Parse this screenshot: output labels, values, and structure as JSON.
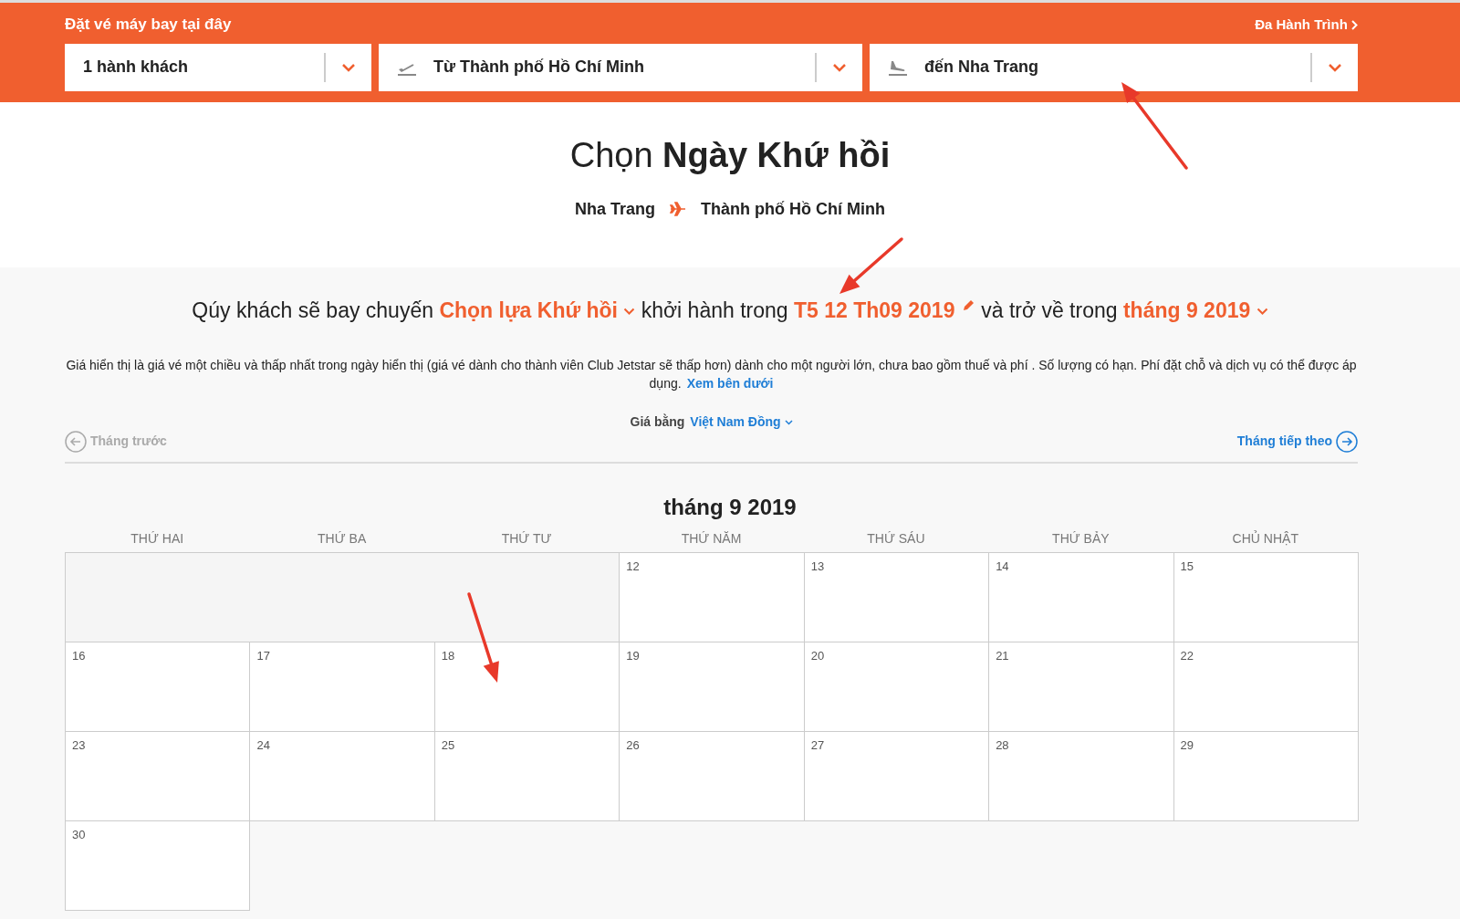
{
  "header": {
    "title": "Đặt vé máy bay tại đây",
    "multi_link": "Đa Hành Trình",
    "fields": [
      {
        "kind": "passengers",
        "value": "1 hành khách"
      },
      {
        "kind": "departure",
        "value": "Từ Thành phố Hồ Chí Minh"
      },
      {
        "kind": "arrival",
        "value": "đến Nha Trang"
      }
    ]
  },
  "heading": "Chọn **Ngày Khứ hồi**",
  "route": {
    "from": "Nha Trang",
    "to": "Thành phố Hồ Chí Minh"
  },
  "sentence": [
    {
      "kind": "plain",
      "text": "Qúy khách sẽ bay chuyến"
    },
    {
      "kind": "dropdown",
      "text": "Chọn lựa Khứ hồi"
    },
    {
      "kind": "plain",
      "text": "khởi hành trong"
    },
    {
      "kind": "edit",
      "text": "T5 12 Th09 2019"
    },
    {
      "kind": "plain",
      "text": "và trở về trong"
    },
    {
      "kind": "dropdown",
      "text": "tháng 9 2019"
    }
  ],
  "note": {
    "text": "Giá hiển thị là giá vé một chiều và thấp nhất trong ngày hiển thị (giá vé dành cho thành viên Club Jetstar sẽ thấp hơn) dành cho một người lớn, chưa bao gồm thuế và phí . Số lượng có hạn. Phí đặt chỗ và dịch vụ có thể được áp dụng.",
    "link": "Xem bên dưới"
  },
  "currency": {
    "label": "Giá bằng",
    "value": "Việt Nam Đồng"
  },
  "prev_month": {
    "label": "Tháng trước",
    "disabled": true
  },
  "next_month": {
    "label": "Tháng tiếp theo",
    "disabled": false
  },
  "calendar": {
    "title": "tháng 9 2019",
    "weekdays": [
      "THỨ HAI",
      "THỨ BA",
      "THỨ TƯ",
      "THỨ NĂM",
      "THỨ SÁU",
      "THỨ BẢY",
      "CHỦ NHẬT"
    ],
    "weeks": [
      [
        {
          "kind": "blank"
        },
        {
          "kind": "blank"
        },
        {
          "kind": "blank"
        },
        {
          "kind": "day",
          "day": "12"
        },
        {
          "kind": "day",
          "day": "13"
        },
        {
          "kind": "day",
          "day": "14"
        },
        {
          "kind": "day",
          "day": "15"
        }
      ],
      [
        {
          "kind": "day",
          "day": "16"
        },
        {
          "kind": "day",
          "day": "17"
        },
        {
          "kind": "day",
          "day": "18"
        },
        {
          "kind": "day",
          "day": "19"
        },
        {
          "kind": "day",
          "day": "20"
        },
        {
          "kind": "day",
          "day": "21"
        },
        {
          "kind": "day",
          "day": "22"
        }
      ],
      [
        {
          "kind": "day",
          "day": "23"
        },
        {
          "kind": "day",
          "day": "24"
        },
        {
          "kind": "day",
          "day": "25"
        },
        {
          "kind": "day",
          "day": "26"
        },
        {
          "kind": "day",
          "day": "27"
        },
        {
          "kind": "day",
          "day": "28"
        },
        {
          "kind": "day",
          "day": "29"
        }
      ],
      [
        {
          "kind": "day",
          "day": "30"
        }
      ]
    ]
  }
}
